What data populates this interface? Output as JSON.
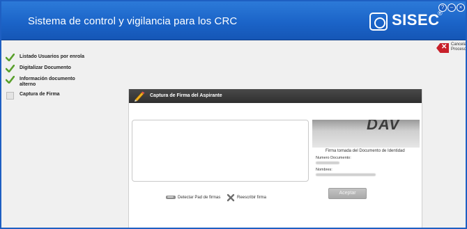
{
  "app": {
    "title": "Sistema de control y vigilancia para los CRC",
    "brand": "SISEC",
    "brand_mark": "®"
  },
  "window_controls": {
    "help": "?",
    "minimize": "–",
    "close": "×"
  },
  "cancel": {
    "label": "Cancelar Proceso"
  },
  "steps": [
    {
      "label": "Listado Usuarios por enrola",
      "status": "done"
    },
    {
      "label": "Digitalizar Documento",
      "status": "done"
    },
    {
      "label": "Información documento alterno",
      "status": "done"
    },
    {
      "label": "Captura de Firma",
      "status": "pending"
    }
  ],
  "panel": {
    "title": "Captura de Firma del Aspirante",
    "doc_caption": "Firma tomada del Documento de Identidad",
    "doc_number_label": "Numero Documento:",
    "names_label": "Nombres:",
    "detect_label": "Detectar Pad de firmas",
    "rewrite_label": "Reescribir firma",
    "accept_label": "Aceptar"
  },
  "colors": {
    "titlebar": "#1b64c8",
    "check": "#5aa02c",
    "cancel": "#c8202a"
  }
}
